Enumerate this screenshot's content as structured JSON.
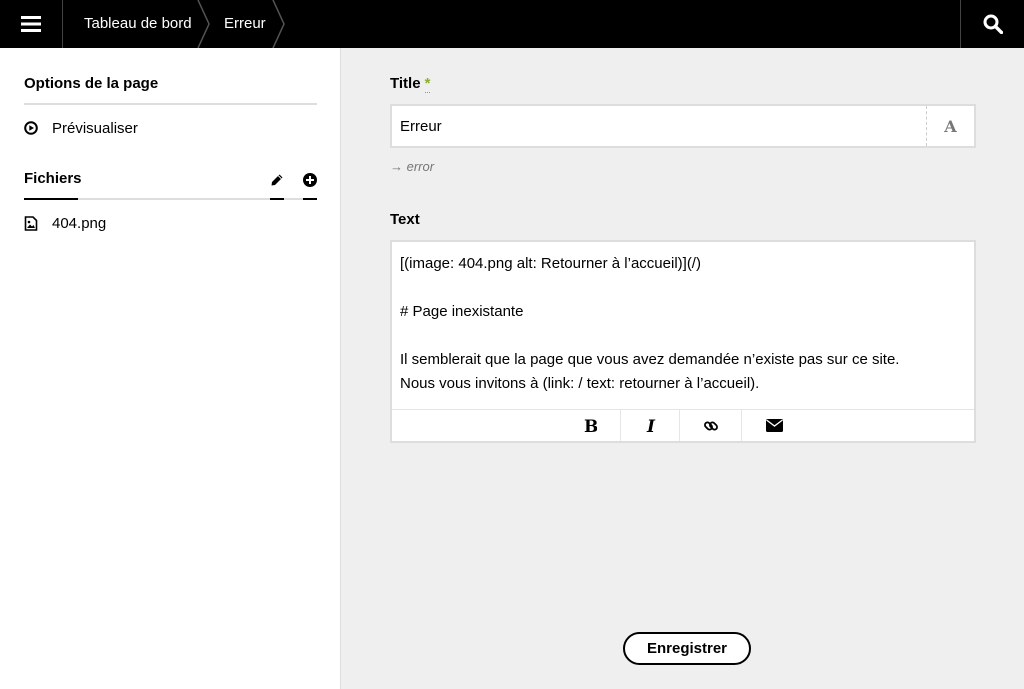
{
  "topbar": {
    "menu_icon": "hamburger-menu-icon",
    "search_icon": "search-icon",
    "breadcrumb": [
      {
        "label": "Tableau de bord"
      },
      {
        "label": "Erreur"
      }
    ]
  },
  "sidebar": {
    "page_options_heading": "Options de la page",
    "preview_label": "Prévisualiser",
    "files_heading": "Fichiers",
    "files": [
      {
        "name": "404.png",
        "icon": "image-file-icon"
      }
    ]
  },
  "form": {
    "title_label": "Title",
    "required_mark": "*",
    "title_value": "Erreur",
    "slug_button_glyph": "A",
    "slug_hint": "error",
    "text_label": "Text",
    "text_lines": [
      "[(image: 404.png alt: Retourner à l’accueil)](/)",
      "",
      "# Page inexistante",
      "",
      "Il semblerait que la page que vous avez demandée n’existe pas sur ce site.",
      "Nous vous invitons à (link: / text: retourner à l’accueil)."
    ],
    "editor_buttons": [
      {
        "name": "bold",
        "icon": "bold-icon"
      },
      {
        "name": "italic",
        "icon": "italic-icon"
      },
      {
        "name": "link",
        "icon": "link-icon"
      },
      {
        "name": "email",
        "icon": "envelope-icon"
      }
    ],
    "save_label": "Enregistrer"
  },
  "colors": {
    "topbar_bg": "#000000",
    "required_accent": "#8dae28",
    "main_bg": "#efefef"
  }
}
